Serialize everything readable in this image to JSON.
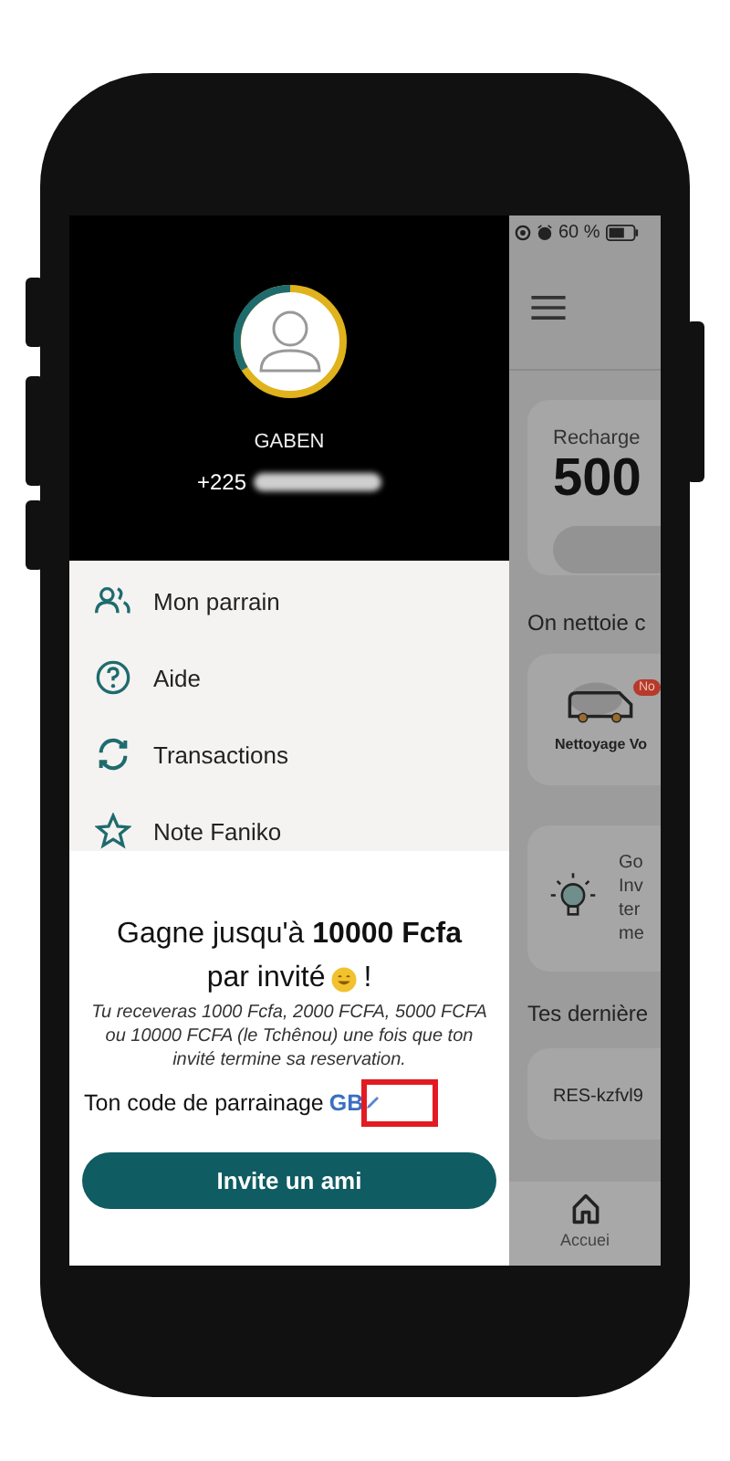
{
  "status_bar": {
    "battery_text": "60 %"
  },
  "drawer": {
    "profile": {
      "name": "GABEN",
      "phone_prefix": "+225"
    },
    "menu": [
      {
        "kind": "people",
        "label": "Mon parrain"
      },
      {
        "kind": "help",
        "label": "Aide"
      },
      {
        "kind": "refresh",
        "label": "Transactions"
      },
      {
        "kind": "star",
        "label": "Note Faniko"
      }
    ]
  },
  "referral": {
    "title": "Gagne jusqu'à **10000 Fcfa**",
    "title_line2": "par invité",
    "title_end": "!",
    "description": "Tu receveras 1000 Fcfa, 2000 FCFA, 5000 FCFA ou 10000 FCFA (le Tchênou) une fois que ton invité  termine sa reservation.",
    "code_label": "Ton code de parrainage",
    "code": "GB",
    "button": "Invite un ami"
  },
  "background_screen": {
    "recharge_label": "Recharge",
    "recharge_amount": "500",
    "section_title": "On nettoie c",
    "service": {
      "label": "Nettoyage Vo",
      "badge": "No"
    },
    "tip_lines": [
      "Go",
      "Inv",
      "ter",
      "me"
    ],
    "recent_title": "Tes dernière",
    "recent_item": "RES-kzfvl9",
    "nav_label": "Accuei"
  }
}
